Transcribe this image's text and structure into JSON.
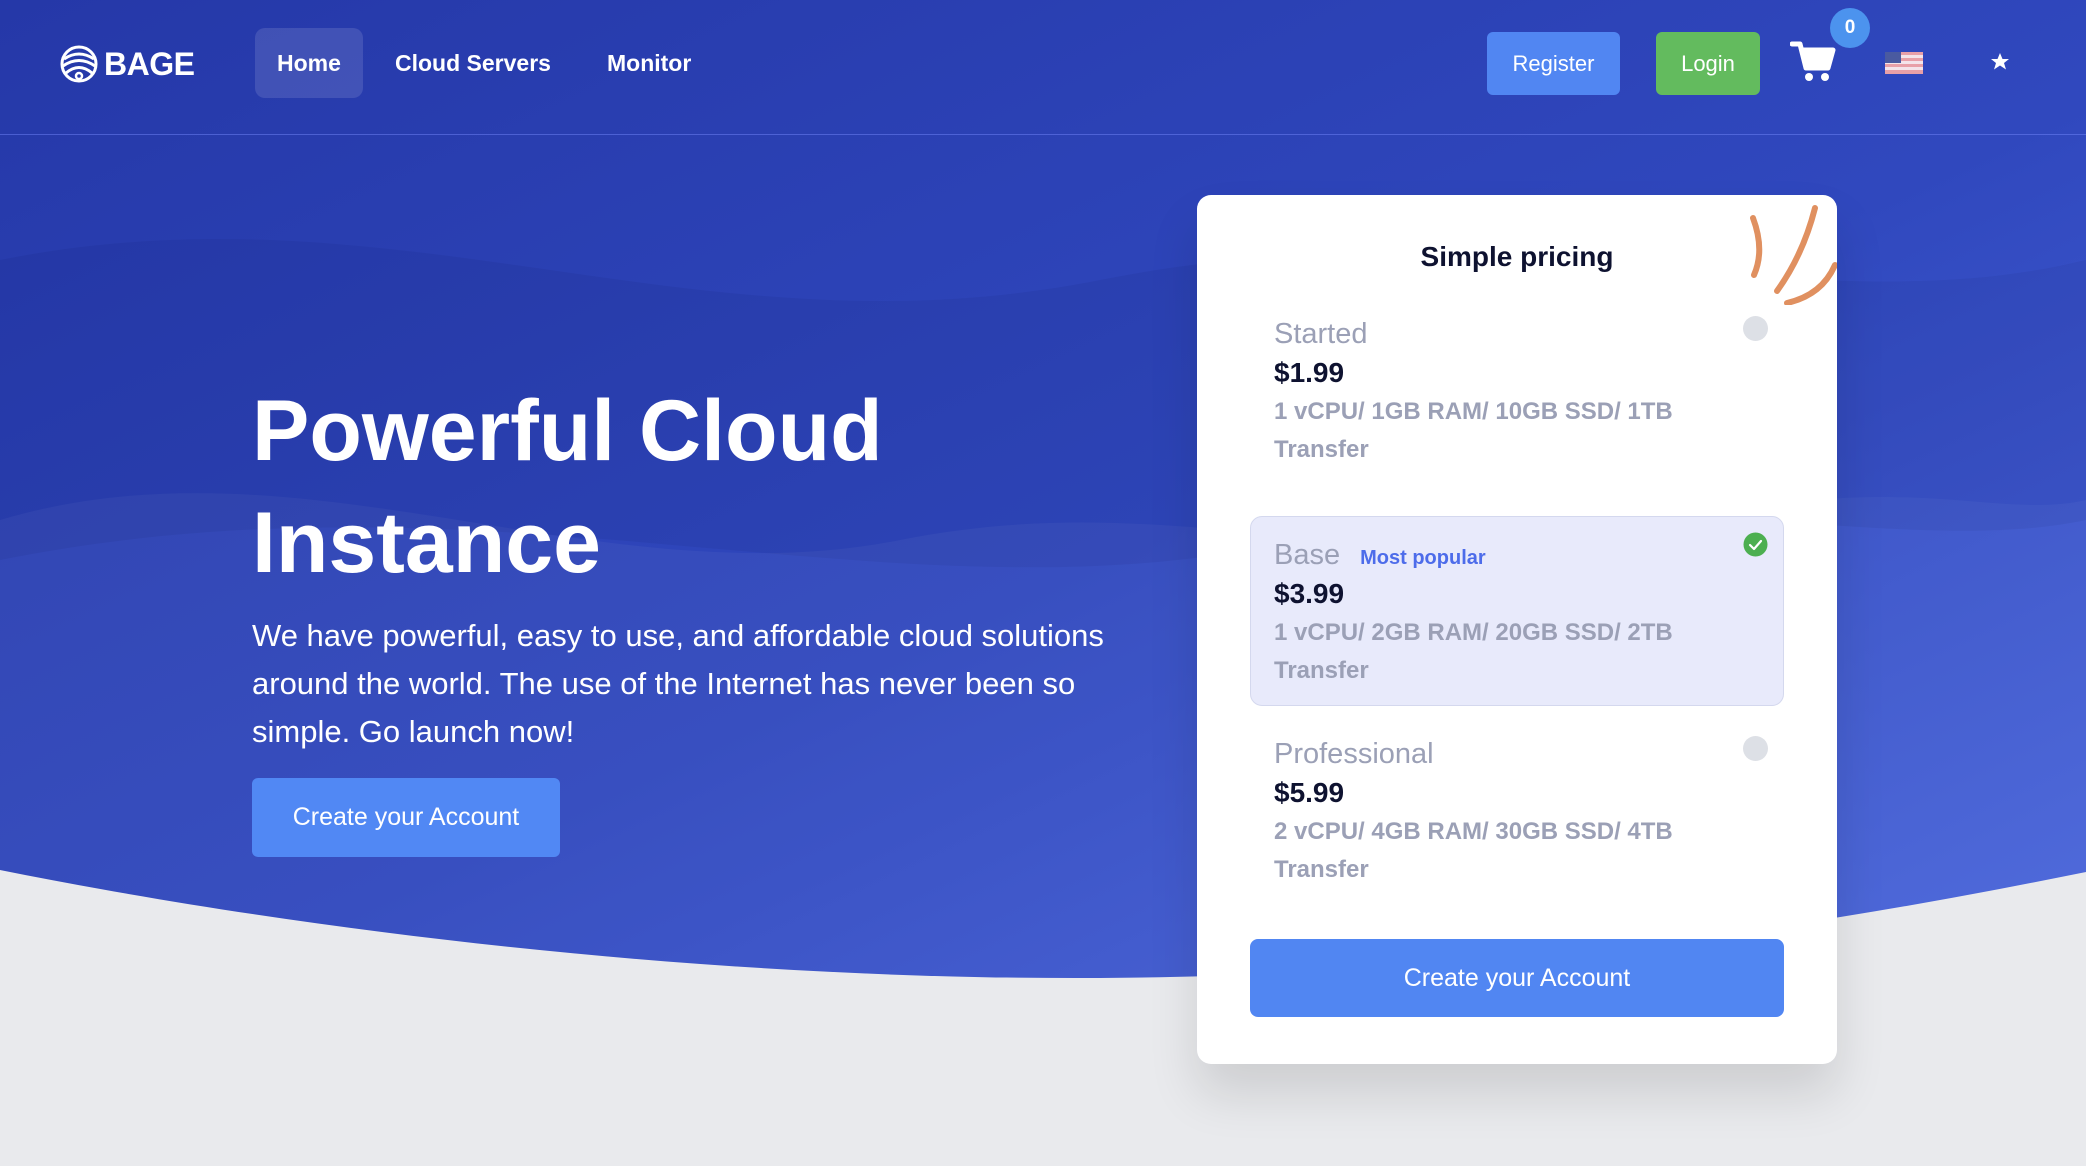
{
  "brand": {
    "name": "BAGE"
  },
  "nav": {
    "items": [
      {
        "label": "Home",
        "active": true
      },
      {
        "label": "Cloud Servers",
        "active": false
      },
      {
        "label": "Monitor",
        "active": false
      }
    ]
  },
  "header_actions": {
    "register_label": "Register",
    "login_label": "Login",
    "cart_count": "0",
    "cart_icon": "shopping-cart-icon",
    "language_icon": "us-flag-icon",
    "theme_icon": "moon-star-icon"
  },
  "hero": {
    "title": "Powerful Cloud Instance",
    "subtitle": "We have powerful, easy to use, and affordable cloud solutions around the world. The use of the Internet has never been so simple. Go launch now!",
    "cta_label": "Create your Account"
  },
  "pricing": {
    "title": "Simple pricing",
    "plans": [
      {
        "name": "Started",
        "badge": "",
        "price": "$1.99",
        "specs": "1 vCPU/ 1GB RAM/ 10GB SSD/ 1TB Transfer",
        "selected": false
      },
      {
        "name": "Base",
        "badge": "Most popular",
        "price": "$3.99",
        "specs": "1 vCPU/ 2GB RAM/ 20GB SSD/ 2TB Transfer",
        "selected": true
      },
      {
        "name": "Professional",
        "badge": "",
        "price": "$5.99",
        "specs": "2 vCPU/ 4GB RAM/ 30GB SSD/ 4TB Transfer",
        "selected": false
      }
    ],
    "cta_label": "Create your Account"
  },
  "colors": {
    "hero_blue": "#2c3fb0",
    "primary_button": "#5186f2",
    "login_green": "#63bb5e",
    "badge_blue": "#4d6cea",
    "check_green": "#4caf50",
    "accent_orange": "#e09060",
    "page_gray": "#e9eaed"
  }
}
